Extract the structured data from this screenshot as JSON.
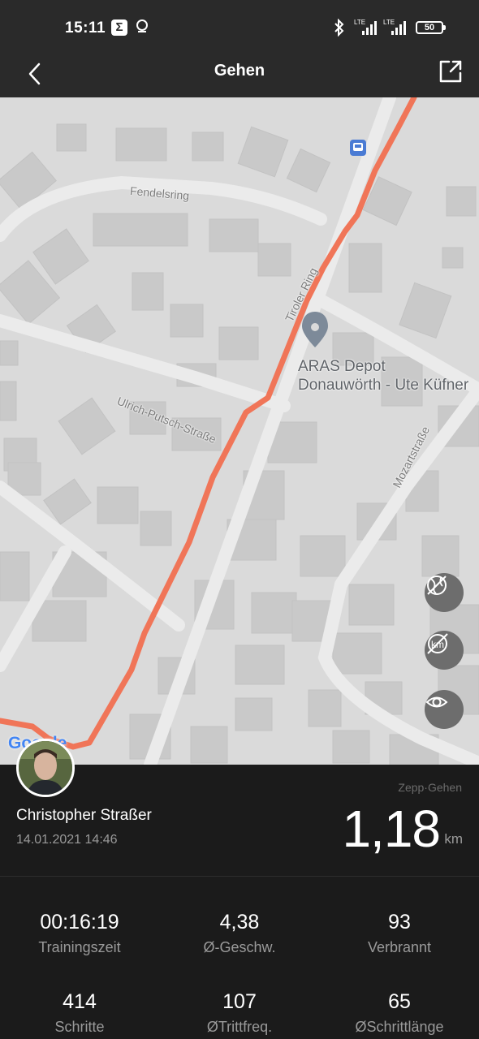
{
  "status_bar": {
    "time": "15:11",
    "sigma_glyph": "Σ",
    "battery": "50",
    "network_1": "LTE",
    "network_2": "LTE",
    "icons": [
      "sigma-icon",
      "location-icon",
      "bluetooth-icon",
      "signal-icon",
      "battery-icon"
    ]
  },
  "header": {
    "title": "Gehen",
    "back_icon": "chevron-left-icon",
    "share_icon": "share-icon"
  },
  "map": {
    "streets": [
      "Fendelsring",
      "Tiroler Ring",
      "Ulrich-Putsch-Straße",
      "Mozartstraße"
    ],
    "poi_line1": "ARAS Depot",
    "poi_line2": "Donauwörth - Ute Küfner",
    "attribution": "Google",
    "route_color": "#f07558",
    "buttons": [
      "hide-map-icon",
      "hide-km-markers-icon",
      "visibility-icon"
    ]
  },
  "summary": {
    "app_label": "Zepp·Gehen",
    "user_name": "Christopher Straßer",
    "date": "14.01.2021 14:46",
    "distance": "1,18",
    "distance_unit": "km"
  },
  "stats": [
    {
      "value": "00:16:19",
      "label": "Trainingszeit"
    },
    {
      "value": "4,38",
      "label": "Ø-Geschw."
    },
    {
      "value": "93",
      "label": "Verbrannt"
    },
    {
      "value": "414",
      "label": "Schritte"
    },
    {
      "value": "107",
      "label": "ØTrittfreq."
    },
    {
      "value": "65",
      "label": "ØSchrittlänge"
    }
  ]
}
